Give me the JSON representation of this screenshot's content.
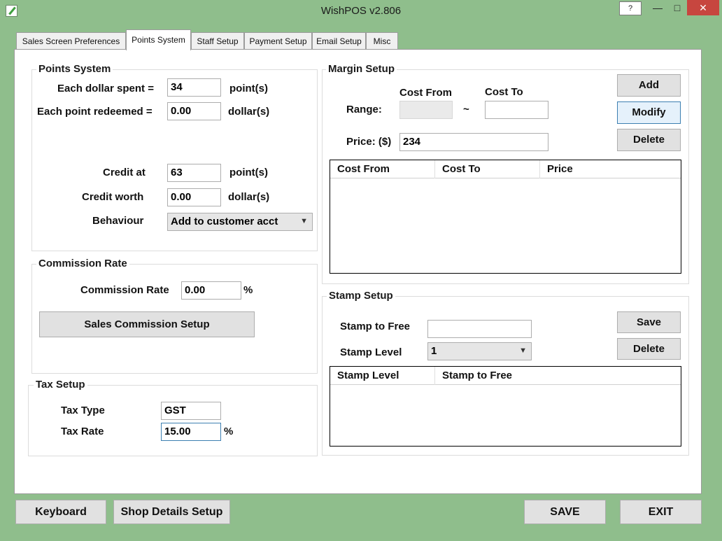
{
  "window": {
    "title": "WishPOS v2.806",
    "help_label": "?",
    "minimize_glyph": "—",
    "maximize_glyph": "□",
    "close_glyph": "✕"
  },
  "tabs": [
    {
      "label": "Sales Screen Preferences",
      "active": false
    },
    {
      "label": "Points System",
      "active": true
    },
    {
      "label": "Staff Setup",
      "active": false
    },
    {
      "label": "Payment Setup",
      "active": false
    },
    {
      "label": "Email Setup",
      "active": false
    },
    {
      "label": "Misc",
      "active": false
    }
  ],
  "points_system": {
    "title": "Points System",
    "each_dollar_label": "Each dollar spent =",
    "each_dollar_value": "34",
    "each_dollar_unit": "point(s)",
    "each_point_label": "Each point redeemed =",
    "each_point_value": "0.00",
    "each_point_unit": "dollar(s)",
    "credit_at_label": "Credit at",
    "credit_at_value": "63",
    "credit_at_unit": "point(s)",
    "credit_worth_label": "Credit worth",
    "credit_worth_value": "0.00",
    "credit_worth_unit": "dollar(s)",
    "behaviour_label": "Behaviour",
    "behaviour_value": "Add to customer acct"
  },
  "commission": {
    "title": "Commission Rate",
    "rate_label": "Commission Rate",
    "rate_value": "0.00",
    "rate_unit": "%",
    "setup_button": "Sales Commission Setup"
  },
  "tax": {
    "title": "Tax Setup",
    "type_label": "Tax Type",
    "type_value": "GST",
    "rate_label": "Tax Rate",
    "rate_value": "15.00",
    "rate_unit": "%"
  },
  "margin": {
    "title": "Margin Setup",
    "cost_from_label": "Cost From",
    "cost_to_label": "Cost To",
    "range_label": "Range:",
    "range_sep": "~",
    "cost_from_value": "",
    "cost_to_value": "",
    "price_label": "Price: ($)",
    "price_value": "234",
    "add_button": "Add",
    "modify_button": "Modify",
    "delete_button": "Delete",
    "columns": [
      "Cost From",
      "Cost To",
      "Price"
    ]
  },
  "stamp": {
    "title": "Stamp Setup",
    "stamp_to_free_label": "Stamp to Free",
    "stamp_to_free_value": "",
    "stamp_level_label": "Stamp Level",
    "stamp_level_value": "1",
    "save_button": "Save",
    "delete_button": "Delete",
    "columns": [
      "Stamp Level",
      "Stamp to Free"
    ]
  },
  "footer": {
    "keyboard": "Keyboard",
    "shop_details": "Shop Details Setup",
    "save": "SAVE",
    "exit": "EXIT"
  }
}
